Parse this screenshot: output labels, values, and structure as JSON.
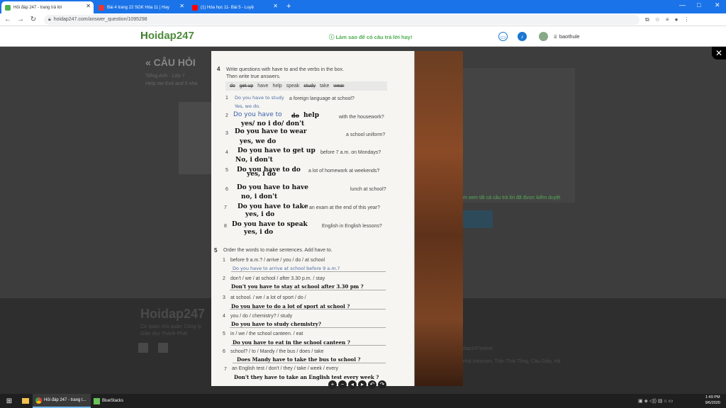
{
  "browser": {
    "tabs": [
      {
        "title": "Hỏi đáp 247 - trang trả lời",
        "active": true,
        "favicon_color": "#4caf50"
      },
      {
        "title": "Bài 4 trang 22 SGK Hóa 11 | Hay",
        "active": false,
        "favicon_color": "#e53935"
      },
      {
        "title": "(1) Hóa học 11- Bài 5 - Luyệ",
        "active": false,
        "favicon_color": "#ff0000"
      }
    ],
    "new_tab": "+",
    "url": "hoidap247.com/answer_question/1095298",
    "window_controls": [
      "—",
      "□",
      "✕"
    ]
  },
  "site": {
    "logo_prefix": "H",
    "logo_rest": "oidap247",
    "tagline": "Làm sao để có câu trả lời hay!",
    "username": "baothule"
  },
  "background_page": {
    "heading": "« CÂU HỎI",
    "subject": "Tiếng Anh · Lớp 7",
    "question_preview": "Help me Ex4 and 5 nha",
    "footer_logo": "Hoidap247",
    "footer_line1": "Cơ quan chủ quản: Công ty",
    "footer_line2": "Giáo dục Thành Phát",
    "footer_right1": "dap247online",
    "footer_right2": "nhà Intracom, Trần Thái Tông, Cầu Giấy, Hà",
    "side_note": "m xem tất cả câu trả lời đã được kiểm duyệt"
  },
  "worksheet": {
    "ex4_num": "4",
    "ex4_title": "Write questions with have to and the verbs in the box.",
    "ex4_sub": "Then write true answers.",
    "verb_box": [
      "do",
      "get up",
      "have",
      "help",
      "speak",
      "study",
      "take",
      "wear"
    ],
    "ex4_items": [
      {
        "n": "1",
        "q": "Do you have to study",
        "rest": "a foreign language at school?",
        "a": "Yes, we do."
      },
      {
        "n": "2",
        "q": "Do you have to",
        "verb_struck": "do",
        "verb": "help",
        "rest": "with the housework?",
        "a": "yes/ no   i do/ don't"
      },
      {
        "n": "3",
        "q": "Do you have to wear",
        "rest": "a school uniform?",
        "a": "yes, we do"
      },
      {
        "n": "4",
        "q": "Do you have to get up",
        "rest": "before 7 a.m. on Mondays?",
        "a": "No, i don't"
      },
      {
        "n": "5",
        "q": "Do you have to do",
        "rest": "a lot of homework at weekends?",
        "a": "yes, i do"
      },
      {
        "n": "6",
        "q": "Do you have to have",
        "rest": "lunch at school?",
        "a": "no, i don't"
      },
      {
        "n": "7",
        "q": "Do you have to take",
        "rest": "an exam at the end of this year?",
        "a": "yes, i do"
      },
      {
        "n": "8",
        "q": "Do you have to speak",
        "rest": "English in English lessons?",
        "a": "yes, i do"
      }
    ],
    "ex5_num": "5",
    "ex5_title": "Order the words to make sentences. Add have to.",
    "ex5_items": [
      {
        "n": "1",
        "words": "before 9 a.m.? / arrive / you / do / at school",
        "a": "Do you have to arrive at school before 9 a.m.?"
      },
      {
        "n": "2",
        "words": "don't / we / at school / after 3.30 p.m. / stay",
        "a": "Don't you have to stay at school after 3.30 pm ?"
      },
      {
        "n": "3",
        "words": "at school. / we / a lot of sport / do /",
        "a": "Do you have to do a lot of sport at school ?"
      },
      {
        "n": "4",
        "words": "you / do / chemistry? / study",
        "a": "Do you have to study chemistry?"
      },
      {
        "n": "5",
        "words": "in / we / the school canteen. / eat",
        "a": "Do you have to eat in the school canteen ?"
      },
      {
        "n": "6",
        "words": "school? / to / Mandy / the bus / does / take",
        "a": "Does Mandy have to take the bus to school ?"
      },
      {
        "n": "7",
        "words": "an English test / don't / they / take / week / every",
        "a": "Don't they have to take an English test every week ?"
      }
    ]
  },
  "viewer_controls": [
    "+",
    "−",
    "◂",
    "▸",
    "↶",
    "↷"
  ],
  "taskbar": {
    "items": [
      {
        "label": "Hỏi đáp 247 - trang t...",
        "active": true
      },
      {
        "label": "BlueStacks",
        "active": false
      }
    ],
    "time": "1:49 PM",
    "date": "9/6/2020"
  },
  "colors": {
    "chrome_blue": "#1a73e8",
    "brand_green": "#4e8b3a"
  }
}
